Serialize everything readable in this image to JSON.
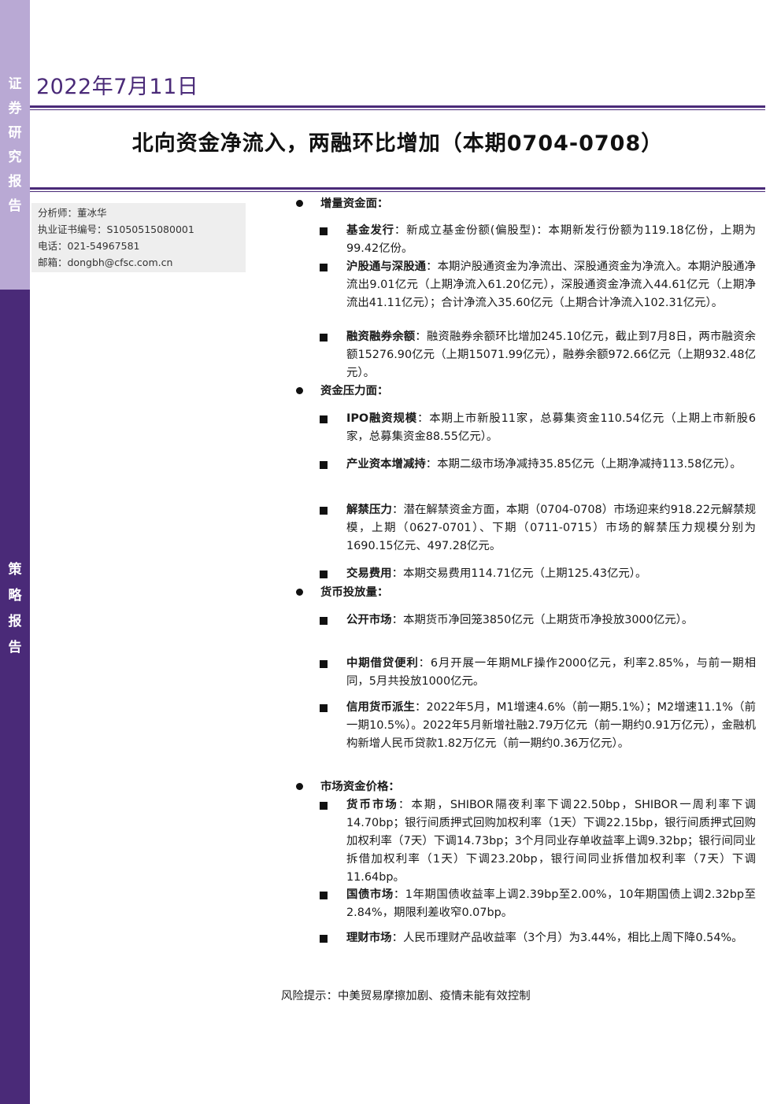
{
  "sidebar": {
    "top_chars": [
      "证",
      "券",
      "研",
      "究",
      "报",
      "告"
    ],
    "bottom_chars": [
      "策",
      "略",
      "报",
      "告"
    ]
  },
  "header": {
    "date": "2022年7月11日",
    "title": "北向资金净流入，两融环比增加（本期0704-0708）"
  },
  "analyst": {
    "name": "分析师：董冰华",
    "cert": "执业证书编号：S1050515080001",
    "phone": "电话：021-54967581",
    "email": "邮箱：dongbh@cfsc.com.cn"
  },
  "sections": [
    {
      "heading": "增量资金面：",
      "items": [
        {
          "label": "基金发行",
          "sep": "：",
          "text": "新成立基金份额(偏股型)：本期新发行份额为119.18亿份，上期为99.42亿份。"
        },
        {
          "label": "沪股通与深股通",
          "sep": "：",
          "text": "本期沪股通资金为净流出、深股通资金为净流入。本期沪股通净流出9.01亿元（上期净流入61.20亿元），深股通资金净流入44.61亿元（上期净流出41.11亿元）；合计净流入35.60亿元（上期合计净流入102.31亿元）。"
        },
        {
          "label": "融资融券余额",
          "sep": "：",
          "text": "融资融券余额环比增加245.10亿元，截止到7月8日，两市融资余额15276.90亿元（上期15071.99亿元），融券余额972.66亿元（上期932.48亿元）。"
        }
      ]
    },
    {
      "heading": "资金压力面：",
      "items": [
        {
          "label": "IPO融资规模",
          "sep": "：",
          "text": "本期上市新股11家，总募集资金110.54亿元（上期上市新股6家，总募集资金88.55亿元）。"
        },
        {
          "label": "产业资本增减持",
          "sep": "：",
          "text": "本期二级市场净减持35.85亿元（上期净减持113.58亿元）。"
        },
        {
          "label": "解禁压力",
          "sep": "：",
          "text": "潜在解禁资金方面，本期（0704-0708）市场迎来约918.22元解禁规模，上期（0627-0701）、下期（0711-0715）市场的解禁压力规模分别为1690.15亿元、497.28亿元。"
        },
        {
          "label": "交易费用",
          "sep": "：",
          "text": "本期交易费用114.71亿元（上期125.43亿元）。"
        }
      ]
    },
    {
      "heading": "货币投放量：",
      "items": [
        {
          "label": "公开市场",
          "sep": "：",
          "text": "本期货币净回笼3850亿元（上期货币净投放3000亿元）。"
        },
        {
          "label": "中期借贷便利",
          "sep": "：",
          "text": "6月开展一年期MLF操作2000亿元，利率2.85%，与前一期相同，5月共投放1000亿元。"
        },
        {
          "label": "信用货币派生",
          "sep": "：",
          "text": "2022年5月，M1增速4.6%（前一期5.1%）；M2增速11.1%（前一期10.5%）。2022年5月新增社融2.79万亿元（前一期约0.91万亿元），金融机构新增人民币贷款1.82万亿元（前一期约0.36万亿元）。"
        }
      ]
    },
    {
      "heading": "市场资金价格：",
      "items": [
        {
          "label": "货币市场",
          "sep": "：",
          "text": "本期，SHIBOR隔夜利率下调22.50bp，SHIBOR一周利率下调14.70bp；银行间质押式回购加权利率（1天）下调22.15bp，银行间质押式回购加权利率（7天）下调14.73bp；3个月同业存单收益率上调9.32bp；银行间同业拆借加权利率（1天）下调23.20bp，银行间同业拆借加权利率（7天）下调11.64bp。"
        },
        {
          "label": "国债市场",
          "sep": "：",
          "text": "1年期国债收益率上调2.39bp至2.00%，10年期国债上调2.32bp至2.84%，期限利差收窄0.07bp。"
        },
        {
          "label": "理财市场",
          "sep": "：",
          "text": "人民币理财产品收益率（3个月）为3.44%，相比上周下降0.54%。"
        }
      ]
    }
  ],
  "risk": "风险提示：中美贸易摩擦加剧、疫情未能有效控制"
}
